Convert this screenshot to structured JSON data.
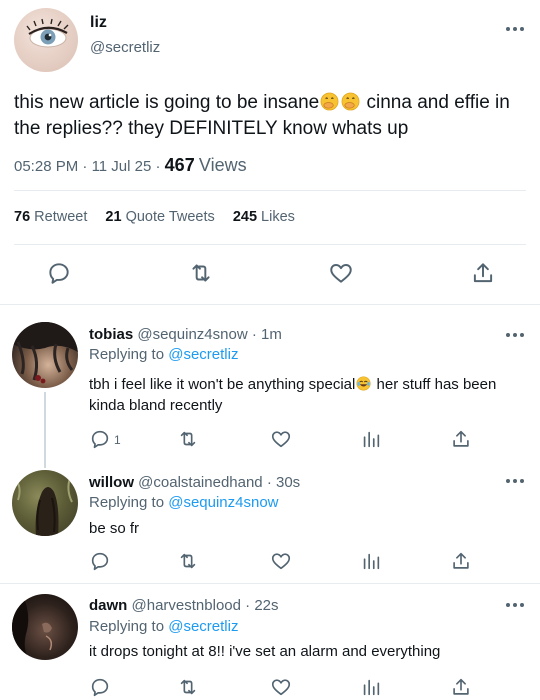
{
  "main_tweet": {
    "name": "liz",
    "handle": "@secretliz",
    "text_part1": "this new article is going to be insane",
    "text_part2": " cinna and effie in the replies?? they DEFINITELY know whats up",
    "time": "05:28 PM",
    "date": "11 Jul 25",
    "views_count": "467",
    "views_label": "Views",
    "retweets_count": "76",
    "retweets_label": "Retweet",
    "quotes_count": "21",
    "quotes_label": "Quote Tweets",
    "likes_count": "245",
    "likes_label": "Likes"
  },
  "replies": [
    {
      "name": "tobias",
      "handle": "@sequinz4snow",
      "time": "1m",
      "replying_label": "Replying to",
      "replying_to": "@secretliz",
      "text_part1": "tbh i feel like it won't be anything special",
      "text_part2": " her stuff has been kinda bland recently",
      "reply_count": "1"
    },
    {
      "name": "willow",
      "handle": "@coalstainedhand",
      "time": "30s",
      "replying_label": "Replying to",
      "replying_to": "@sequinz4snow",
      "text": "be so fr"
    },
    {
      "name": "dawn",
      "handle": "@harvestnblood",
      "time": "22s",
      "replying_label": "Replying to",
      "replying_to": "@secretliz",
      "text": "it drops tonight at 8!! i've set an alarm and everything"
    }
  ],
  "colors": {
    "text": "#0f1419",
    "secondary": "#536471",
    "link": "#1d9bf0",
    "divider": "#e6ecf0"
  }
}
